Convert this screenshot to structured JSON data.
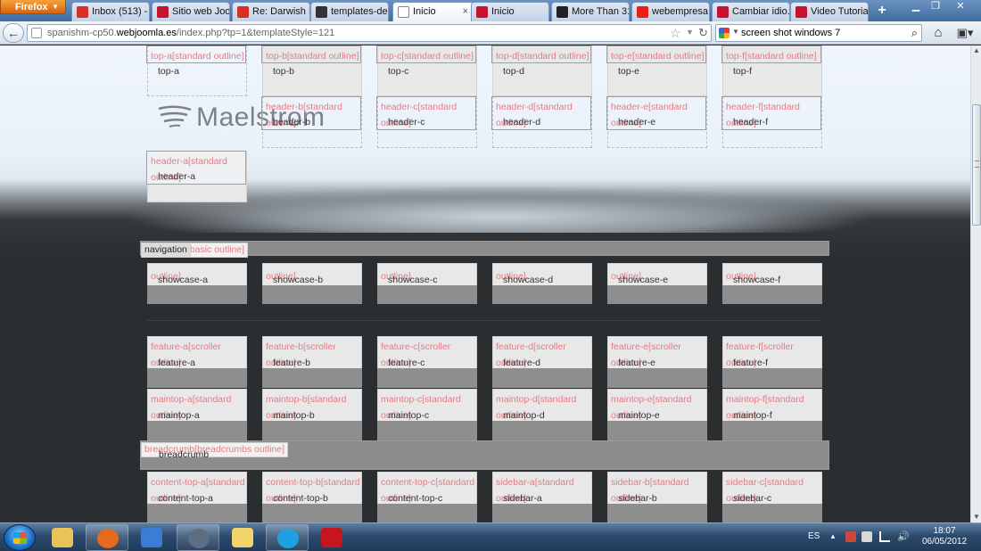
{
  "browser": {
    "menu_label": "Firefox",
    "tabs": [
      {
        "label": "Inbox (513) - ...",
        "favicon": "gmail-icon",
        "color": "#d93025"
      },
      {
        "label": "Sitio web Joo...",
        "favicon": "webempresa-icon",
        "color": "#c4122f"
      },
      {
        "label": "Re: Darwish M...",
        "favicon": "gmail-icon",
        "color": "#d93025"
      },
      {
        "label": "templates-de...",
        "favicon": "github-icon",
        "color": "#333333"
      },
      {
        "label": "Inicio",
        "favicon": "page-icon",
        "color": "#ffffff"
      },
      {
        "label": "Inicio",
        "favicon": "webempresa-icon",
        "color": "#c4122f"
      },
      {
        "label": "More Than 31...",
        "favicon": "stopwatch-icon",
        "color": "#222222"
      },
      {
        "label": "webempresa -...",
        "favicon": "youtube-icon",
        "color": "#e62117"
      },
      {
        "label": "Cambiar idio...",
        "favicon": "webempresa-icon",
        "color": "#c4122f"
      },
      {
        "label": "Video Tutorial...",
        "favicon": "webempresa-icon",
        "color": "#c4122f"
      }
    ],
    "url_domain_prefix": "spanishm-cp50.",
    "url_domain": "webjoomla.es",
    "url_path": "/index.php?tp=1&templateStyle=121",
    "search_text": "screen shot windows 7"
  },
  "page": {
    "logo_text": "Maelstrom",
    "top": [
      {
        "label": "top-a[standard outline]",
        "name": "top-a"
      },
      {
        "label": "top-b[standard outline]",
        "name": "top-b"
      },
      {
        "label": "top-c[standard outline]",
        "name": "top-c"
      },
      {
        "label": "top-d[standard outline]",
        "name": "top-d"
      },
      {
        "label": "top-e[standard outline]",
        "name": "top-e"
      },
      {
        "label": "top-f[standard outline]",
        "name": "top-f"
      }
    ],
    "header": [
      {
        "label": "header-a[standard outline]",
        "name": "header-a"
      },
      {
        "label": "header-b[standard outline]",
        "name": "header-b"
      },
      {
        "label": "header-c[standard outline]",
        "name": "header-c"
      },
      {
        "label": "header-d[standard outline]",
        "name": "header-d"
      },
      {
        "label": "header-e[standard outline]",
        "name": "header-e"
      },
      {
        "label": "header-f[standard outline]",
        "name": "header-f"
      }
    ],
    "navigation_tag": "navigation[basic outline]",
    "navigation_name": "navigation",
    "showcase": [
      {
        "label": "outline]",
        "name": "showcase-a"
      },
      {
        "label": "outline]",
        "name": "showcase-b"
      },
      {
        "label": "outline]",
        "name": "showcase-c"
      },
      {
        "label": "outline]",
        "name": "showcase-d"
      },
      {
        "label": "outline]",
        "name": "showcase-e"
      },
      {
        "label": "outline]",
        "name": "showcase-f"
      }
    ],
    "feature": [
      {
        "label": "feature-a[scroller outline]",
        "name": "feature-a"
      },
      {
        "label": "feature-b[scroller outline]",
        "name": "feature-b"
      },
      {
        "label": "feature-c[scroller outline]",
        "name": "feature-c"
      },
      {
        "label": "feature-d[scroller outline]",
        "name": "feature-d"
      },
      {
        "label": "feature-e[scroller outline]",
        "name": "feature-e"
      },
      {
        "label": "feature-f[scroller outline]",
        "name": "feature-f"
      }
    ],
    "maintop": [
      {
        "label": "maintop-a[standard outline]",
        "name": "maintop-a"
      },
      {
        "label": "maintop-b[standard outline]",
        "name": "maintop-b"
      },
      {
        "label": "maintop-c[standard outline]",
        "name": "maintop-c"
      },
      {
        "label": "maintop-d[standard outline]",
        "name": "maintop-d"
      },
      {
        "label": "maintop-e[standard outline]",
        "name": "maintop-e"
      },
      {
        "label": "maintop-f[standard outline]",
        "name": "maintop-f"
      }
    ],
    "breadcrumb_tag": "breadcrumb[breadcrumbs outline]",
    "breadcrumb_name": "breadcrumb",
    "content_row": [
      {
        "label": "content-top-a[standard outline]",
        "name": "content-top-a"
      },
      {
        "label": "content-top-b[standard outline]",
        "name": "content-top-b"
      },
      {
        "label": "content-top-c[standard outline]",
        "name": "content-top-c"
      },
      {
        "label": "sidebar-a[standard outline]",
        "name": "sidebar-a"
      },
      {
        "label": "sidebar-b[standard outline]",
        "name": "sidebar-b"
      },
      {
        "label": "sidebar-c[standard outline]",
        "name": "sidebar-c"
      }
    ]
  },
  "taskbar": {
    "apps": [
      {
        "name": "explorer-icon",
        "color": "#e8c35a"
      },
      {
        "name": "firefox-icon",
        "color": "#e66a1b"
      },
      {
        "name": "media-player-icon",
        "color": "#3a7dd6"
      },
      {
        "name": "network-globe-icon",
        "color": "#5e6e80"
      },
      {
        "name": "folder-icon",
        "color": "#f2d46a"
      },
      {
        "name": "skype-icon",
        "color": "#1fa0e3"
      },
      {
        "name": "acrobat-icon",
        "color": "#c4161c"
      }
    ],
    "language": "ES",
    "time": "18:07",
    "date": "06/05/2012"
  }
}
